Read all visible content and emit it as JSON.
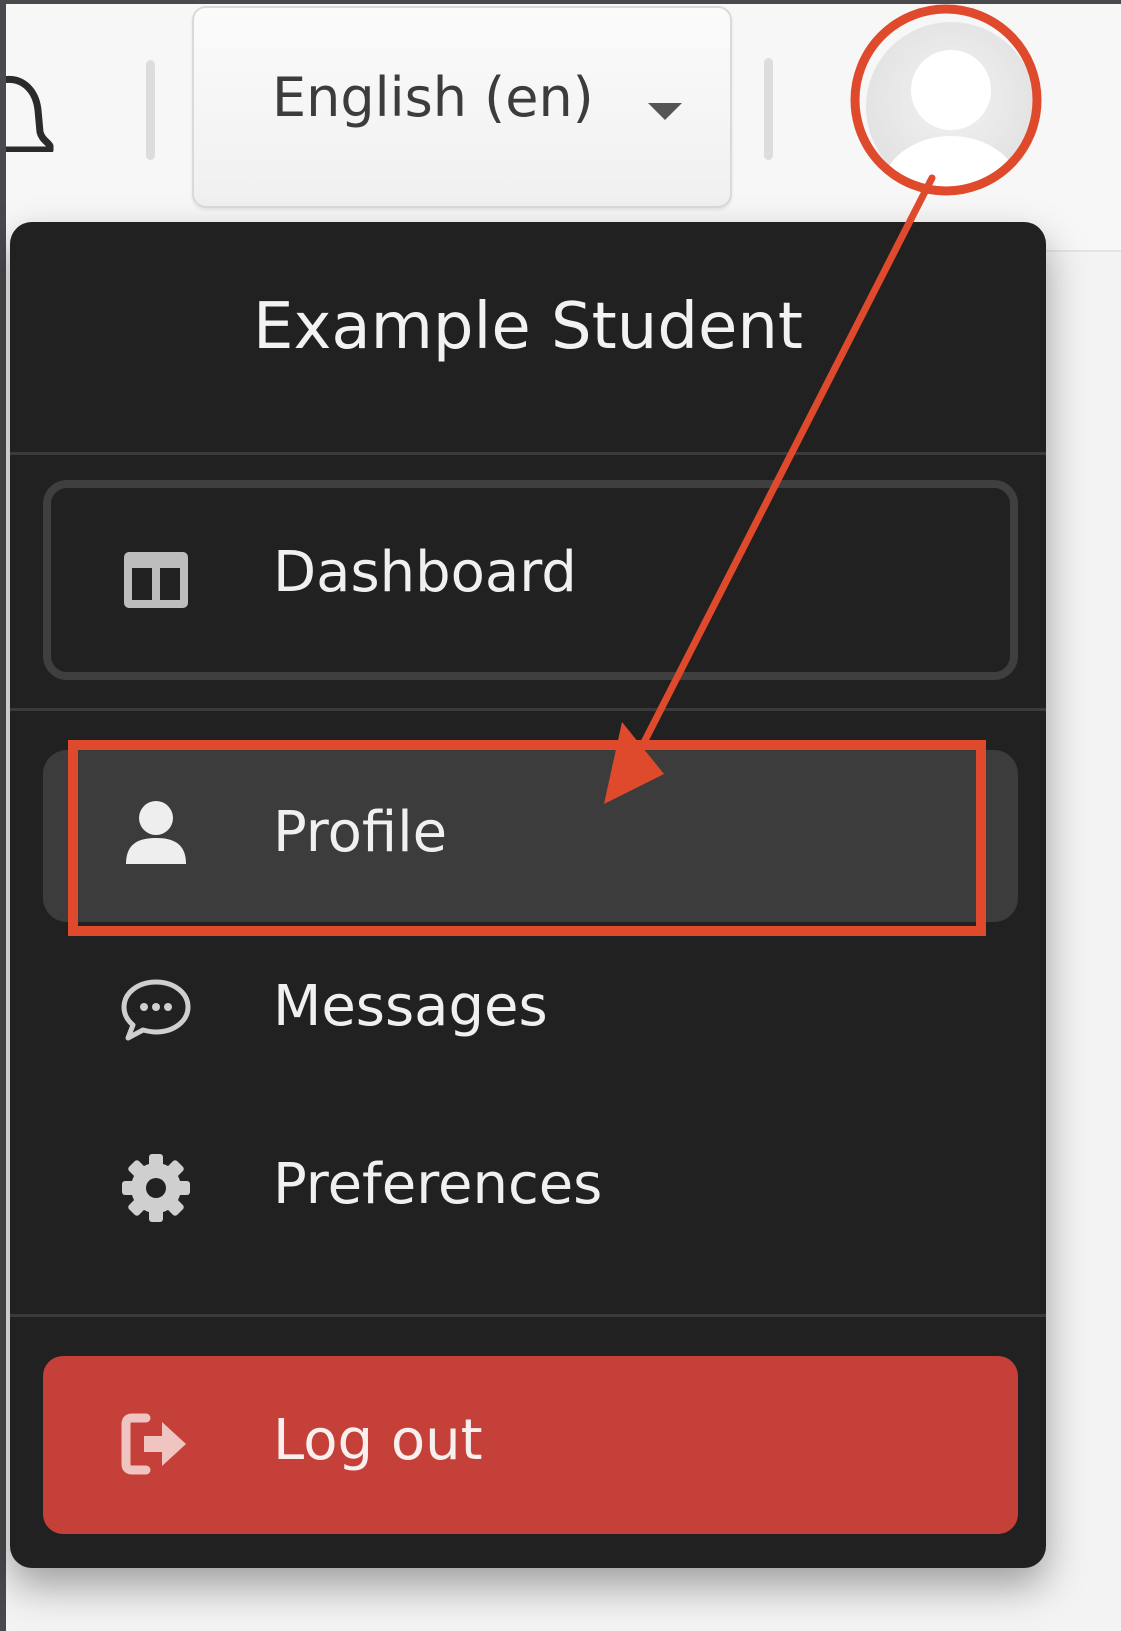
{
  "header": {
    "language_selector": {
      "label": "English (en)",
      "icon": "caret-down-icon"
    },
    "notifications_icon": "bell-icon",
    "avatar_icon": "user-avatar-icon"
  },
  "user_menu": {
    "user_name": "Example Student",
    "items": [
      {
        "label": "Dashboard",
        "icon": "dashboard-icon"
      },
      {
        "label": "Profile",
        "icon": "user-icon"
      },
      {
        "label": "Messages",
        "icon": "chat-icon"
      },
      {
        "label": "Preferences",
        "icon": "gear-icon"
      }
    ],
    "logout": {
      "label": "Log out",
      "icon": "sign-out-icon"
    }
  },
  "colors": {
    "menu_background": "#212121",
    "logout_background": "#c6403a",
    "annotation": "#e04a2c"
  }
}
